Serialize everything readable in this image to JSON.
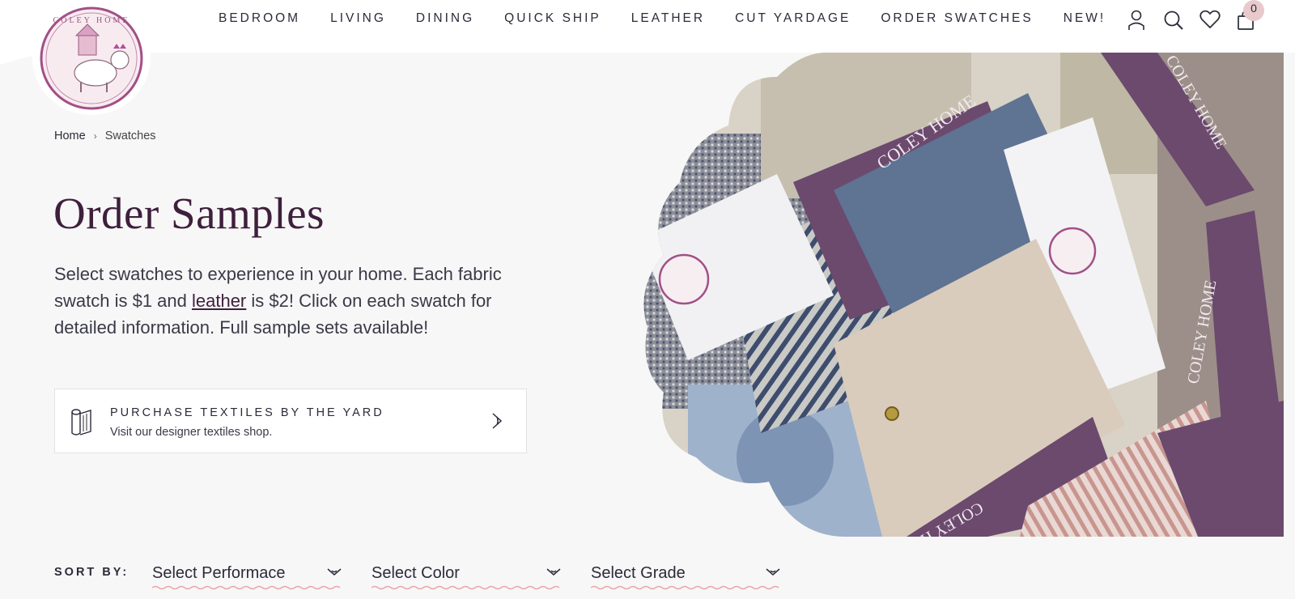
{
  "brand": {
    "logo_alt": "Coley Home",
    "logo_text": "COLEY HOME"
  },
  "nav": {
    "items": [
      {
        "label": "BEDROOM"
      },
      {
        "label": "LIVING"
      },
      {
        "label": "DINING"
      },
      {
        "label": "QUICK SHIP"
      },
      {
        "label": "LEATHER"
      },
      {
        "label": "CUT YARDAGE"
      },
      {
        "label": "ORDER SWATCHES"
      },
      {
        "label": "NEW!"
      }
    ]
  },
  "header_icons": {
    "account": "user-icon",
    "search": "search-icon",
    "wishlist": "heart-icon",
    "cart": "shopping-bag-icon",
    "cart_count": "0"
  },
  "breadcrumb": {
    "home": "Home",
    "current": "Swatches"
  },
  "page": {
    "title": "Order Samples",
    "intro_before": "Select swatches to experience in your home. Each fabric swatch is $1 and ",
    "intro_link": "leather",
    "intro_after": " is $2! Click on each swatch for detailed information. Full sample sets available!"
  },
  "promo": {
    "title": "PURCHASE TEXTILES BY THE YARD",
    "subtitle": "Visit our designer textiles shop.",
    "icon": "fabric-roll-icon"
  },
  "hero": {
    "tag_text": "COLEY HOME"
  },
  "sort": {
    "label": "SORT BY:",
    "selects": [
      {
        "value": "Select Performace"
      },
      {
        "value": "Select Color"
      },
      {
        "value": "Select Grade"
      }
    ]
  },
  "colors": {
    "plum": "#3e1f3c",
    "tag_purple": "#6b4a6e",
    "accent_pink": "#e8a6ac",
    "background": "#f7f7f7"
  }
}
